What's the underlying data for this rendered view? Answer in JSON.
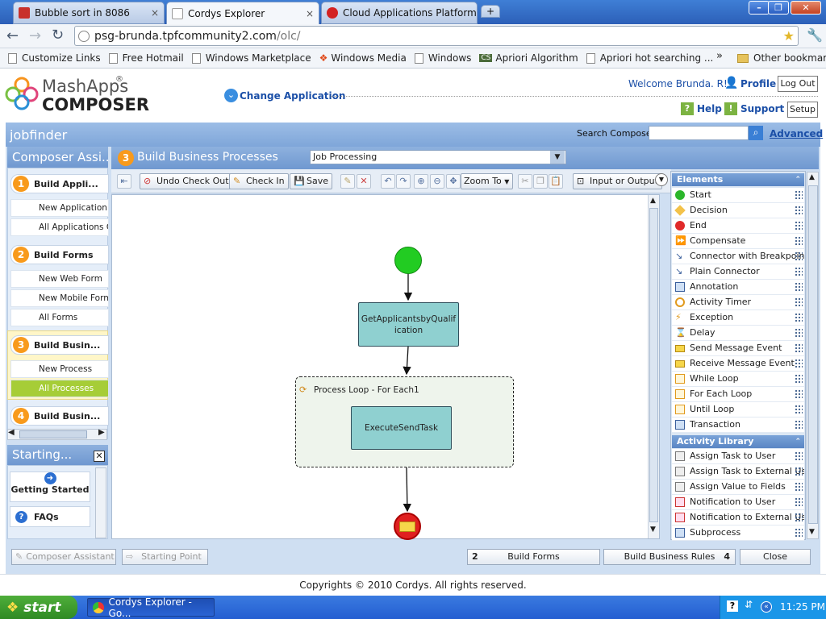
{
  "browser": {
    "tabs": [
      {
        "title": "Bubble sort in 8086",
        "close": "×"
      },
      {
        "title": "Cordys Explorer",
        "close": "×"
      },
      {
        "title": "Cloud Applications Platform...",
        "close": "×"
      }
    ],
    "new_tab": "+",
    "url_host": "psg-brunda.tpfcommunity2.com",
    "url_path": "/olc/",
    "bookmarks": [
      "Customize Links",
      "Free Hotmail",
      "Windows Marketplace",
      "Windows Media",
      "Windows",
      "Apriori Algorithm",
      "Apriori hot searching ..."
    ],
    "bookmarks_more": "»",
    "other_bookmarks": "Other bookmarks"
  },
  "header": {
    "logo_top": "MashApps",
    "logo_reg": "®",
    "logo_bottom": "COMPOSER",
    "change_application": "Change Application",
    "welcome": "Welcome Brunda. R!",
    "profile": "Profile",
    "logout": "Log Out",
    "help": "Help",
    "support": "Support",
    "setup": "Setup"
  },
  "app": {
    "name": "jobfinder",
    "search_label": "Search Composer",
    "search_value": "",
    "advanced": "Advanced"
  },
  "left": {
    "title": "Composer Assi...",
    "sections": [
      {
        "num": "1",
        "label": "Build Appli...",
        "items": [
          "New Application O",
          "All Applications Ob"
        ]
      },
      {
        "num": "2",
        "label": "Build Forms",
        "items": [
          "New Web Form",
          "New Mobile Form",
          "All Forms"
        ]
      },
      {
        "num": "3",
        "label": "Build Busin...",
        "items": [
          "New Process",
          "All Processes"
        ]
      },
      {
        "num": "4",
        "label": "Build Busin...",
        "items": []
      }
    ],
    "starting_title": "Starting...",
    "getting_started": "Getting Started",
    "faqs": "FAQs"
  },
  "process": {
    "step": "3",
    "title": "Build Business Processes",
    "selected_process": "Job Processing",
    "toolbar": {
      "undo_checkout": "Undo Check Out",
      "check_in": "Check In",
      "save": "Save",
      "zoom_to": "Zoom To",
      "input_output": "Input or Output"
    },
    "diagram": {
      "activity1": "GetApplicantsbyQualification",
      "loop_label": "Process Loop - For Each1",
      "activity2": "ExecuteSendTask"
    }
  },
  "elements": {
    "title": "Elements",
    "items": [
      {
        "label": "Start",
        "icon": "start-icon"
      },
      {
        "label": "Decision",
        "icon": "decision-icon"
      },
      {
        "label": "End",
        "icon": "end-icon"
      },
      {
        "label": "Compensate",
        "icon": "compensate-icon"
      },
      {
        "label": "Connector with Breakpoint",
        "icon": "connector-icon"
      },
      {
        "label": "Plain Connector",
        "icon": "connector-icon"
      },
      {
        "label": "Annotation",
        "icon": "annotation-icon"
      },
      {
        "label": "Activity Timer",
        "icon": "timer-icon"
      },
      {
        "label": "Exception",
        "icon": "exception-icon"
      },
      {
        "label": "Delay",
        "icon": "delay-icon"
      },
      {
        "label": "Send Message Event",
        "icon": "mail-icon"
      },
      {
        "label": "Receive Message Event",
        "icon": "mail-icon"
      },
      {
        "label": "While Loop",
        "icon": "loop-icon"
      },
      {
        "label": "For Each Loop",
        "icon": "loop-icon"
      },
      {
        "label": "Until Loop",
        "icon": "loop-icon"
      },
      {
        "label": "Transaction",
        "icon": "transaction-icon"
      }
    ],
    "activity_title": "Activity Library",
    "activities": [
      "Assign Task to User",
      "Assign Task to External Us",
      "Assign Value to Fields",
      "Notification to User",
      "Notification to External Us",
      "Subprocess"
    ]
  },
  "bottom": {
    "composer_assistant": "Composer Assistant",
    "starting_point": "Starting Point",
    "prev_num": "2",
    "prev_label": "Build Forms",
    "next_label": "Build Business Rules",
    "next_num": "4",
    "close": "Close"
  },
  "footer": "Copyrights © 2010 Cordys. All rights reserved.",
  "taskbar": {
    "start": "start",
    "task": "Cordys Explorer - Go...",
    "time": "11:25 PM"
  },
  "colors": {
    "accent": "#1b4fa7",
    "orange": "#f89a1c",
    "selected": "#a6cd37",
    "activity_fill": "#8fd0d0"
  }
}
